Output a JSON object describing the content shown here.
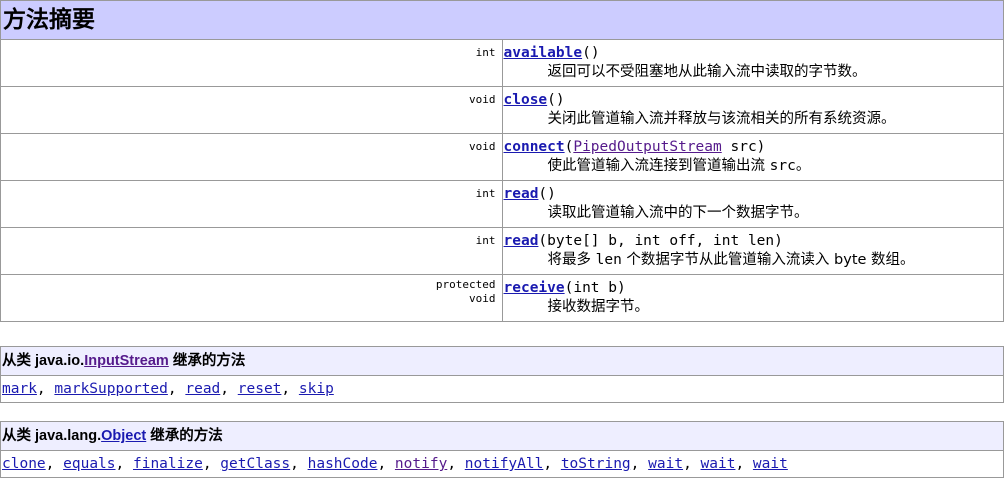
{
  "summary": {
    "title": "方法摘要",
    "methods": [
      {
        "modifier": "int",
        "name": "available",
        "params_open": "(",
        "param_type_link": "",
        "params_rest": ")",
        "description": "返回可以不受阻塞地从此输入流中读取的字节数。"
      },
      {
        "modifier": "void",
        "name": "close",
        "params_open": "(",
        "param_type_link": "",
        "params_rest": ")",
        "description": "关闭此管道输入流并释放与该流相关的所有系统资源。"
      },
      {
        "modifier": "void",
        "name": "connect",
        "params_open": "(",
        "param_type_link": "PipedOutputStream",
        "params_rest": " src)",
        "description_pre": "使此管道输入流连接到管道输出流 ",
        "description_code": "src",
        "description_post": "。"
      },
      {
        "modifier": "int",
        "name": "read",
        "params_open": "(",
        "param_type_link": "",
        "params_rest": ")",
        "description": "读取此管道输入流中的下一个数据字节。"
      },
      {
        "modifier": "int",
        "name": "read",
        "params_open": "(",
        "param_type_link": "",
        "params_rest": "byte[] b, int off, int len)",
        "description_pre": "将最多 ",
        "description_code": "len",
        "description_post": " 个数据字节从此管道输入流读入 byte 数组。"
      },
      {
        "modifier": "protected\nvoid",
        "name": "receive",
        "params_open": "(",
        "param_type_link": "",
        "params_rest": "int b)",
        "description": "接收数据字节。"
      }
    ]
  },
  "inherited": [
    {
      "prefix": "从类 java.io.",
      "class_name": "InputStream",
      "suffix": " 继承的方法",
      "methods": [
        "mark",
        "markSupported",
        "read",
        "reset",
        "skip"
      ]
    },
    {
      "prefix": "从类 java.lang.",
      "class_name": "Object",
      "suffix": " 继承的方法",
      "methods": [
        "clone",
        "equals",
        "finalize",
        "getClass",
        "hashCode",
        "notify",
        "notifyAll",
        "toString",
        "wait",
        "wait",
        "wait"
      ]
    }
  ],
  "colors": {
    "header_bg": "#ccccff",
    "inherit_header_bg": "#eeeeff",
    "link": "#1a1ab0",
    "visited_link": "#551a8b"
  }
}
